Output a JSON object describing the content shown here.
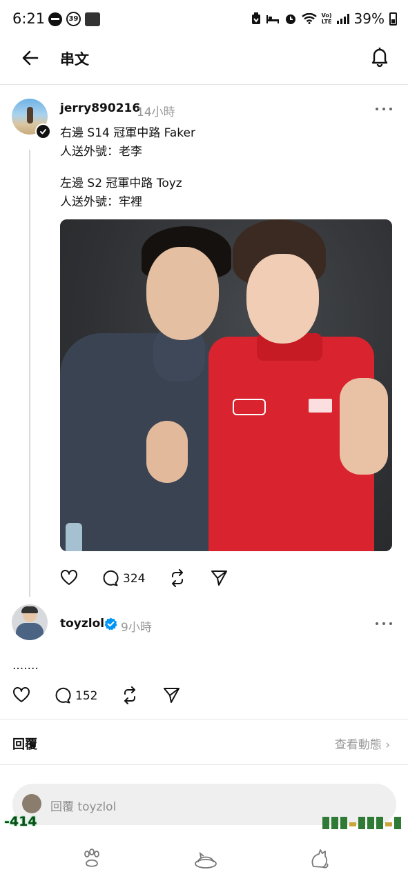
{
  "status_bar": {
    "time": "6:21",
    "notification_badge": "39",
    "network": "LTE",
    "volte": "Vo)",
    "battery": "39%"
  },
  "header": {
    "title": "串文"
  },
  "post": {
    "username": "jerry890216",
    "time": "14小時",
    "text_line1": "右邊 S14 冠軍中路 Faker",
    "text_line2": "人送外號：老李",
    "text_line3": "左邊 S2 冠軍中路 Toyz",
    "text_line4": "人送外號：牢裡",
    "reply_count": "324"
  },
  "reply": {
    "username": "toyzlol",
    "time": "9小時",
    "text": ".......",
    "reply_count": "152"
  },
  "reply_section": {
    "label": "回覆",
    "activity_link": "查看動態 ›"
  },
  "composer": {
    "placeholder": "回覆 toyzlol"
  },
  "overlay": {
    "number": "-414"
  },
  "colors": {
    "accent_verified": "#0095f6",
    "muted_text": "#999999",
    "divider": "#e6e6e6"
  },
  "icons": [
    "back-arrow-icon",
    "bell-icon",
    "more-icon",
    "heart-icon",
    "comment-icon",
    "repost-icon",
    "share-icon",
    "paw-icon",
    "cat-bed-icon",
    "cat-icon"
  ]
}
